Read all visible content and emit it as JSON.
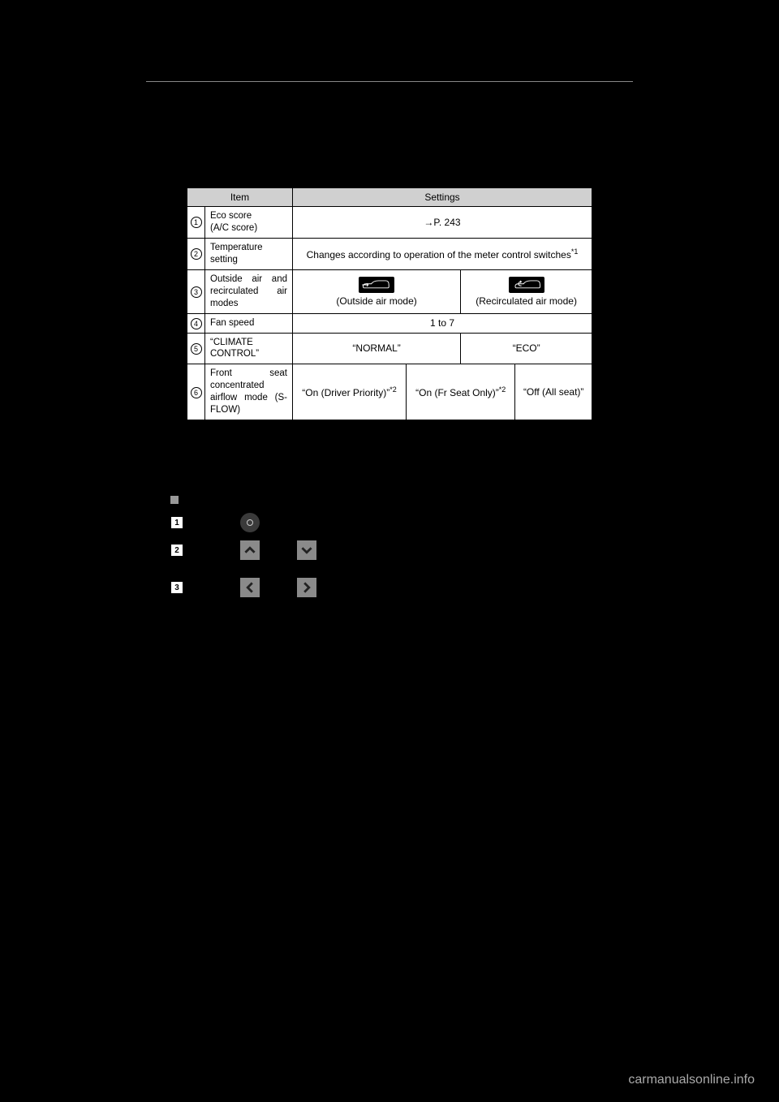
{
  "table": {
    "headers": {
      "item": "Item",
      "settings": "Settings"
    },
    "rows": {
      "r1": {
        "num": "1",
        "item": "Eco score\n(A/C score)",
        "settings": "→P. 243"
      },
      "r2": {
        "num": "2",
        "item": "Temperature setting",
        "settings_prefix": "Changes according to operation of the meter control switches",
        "settings_sup": "*1"
      },
      "r3": {
        "num": "3",
        "item": "Outside air and recirculated air modes",
        "left_label": "(Outside air mode)",
        "right_label": "(Recirculated air mode)"
      },
      "r4": {
        "num": "4",
        "item": "Fan speed",
        "settings": "1 to 7"
      },
      "r5": {
        "num": "5",
        "item": "“CLIMATE CONTROL”",
        "left": "“NORMAL”",
        "right": "“ECO”"
      },
      "r6": {
        "num": "6",
        "item": "Front seat concentrated airflow mode (S-FLOW)",
        "c1_text": "“On (Driver Priority)”",
        "c1_sup": "*2",
        "c2_text": "“On (Fr Seat Only)”",
        "c2_sup": "*2",
        "c3": "“Off (All seat)”"
      }
    }
  },
  "steps": {
    "s1": "1",
    "s2": "2",
    "s3": "3"
  },
  "icons": {
    "enter": "enter-button-icon",
    "up": "up-arrow-icon",
    "down": "down-arrow-icon",
    "left": "left-arrow-icon",
    "right": "right-arrow-icon",
    "outside_air": "outside-air-icon",
    "recirculated_air": "recirculated-air-icon"
  },
  "watermark": "carmanualsonline.info"
}
